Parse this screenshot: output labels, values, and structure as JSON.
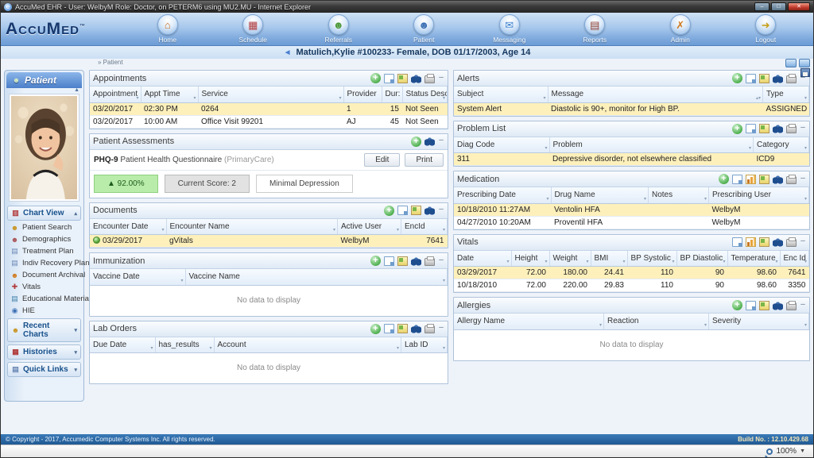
{
  "window": {
    "title": "AccuMed EHR - User: WelbyM Role: Doctor, on PETERM6 using MU2.MU - Internet Explorer",
    "favicon_glyph": "e",
    "min": "–",
    "max": "□",
    "close": "✕"
  },
  "nav": {
    "logo": "AccuMed",
    "logo_tm": "™",
    "items": [
      {
        "label": "Home",
        "glyph": "⌂",
        "color": "#c96a1a"
      },
      {
        "label": "Schedule",
        "glyph": "▦",
        "color": "#b03a3a"
      },
      {
        "label": "Referrals",
        "glyph": "☻",
        "color": "#4f9a3c"
      },
      {
        "label": "Patient",
        "glyph": "☻",
        "color": "#3b6fb4"
      },
      {
        "label": "Messaging",
        "glyph": "✉",
        "color": "#3b7fd0"
      },
      {
        "label": "Reports",
        "glyph": "▤",
        "color": "#8a3a2a"
      },
      {
        "label": "Admin",
        "glyph": "✗",
        "color": "#d07a20"
      },
      {
        "label": "Logout",
        "glyph": "➜",
        "color": "#c8a020"
      }
    ]
  },
  "banner": {
    "arrow": "◄",
    "text": "Matulich,Kylie #100233- Female, DOB 01/17/2003, Age 14"
  },
  "breadcrumb": {
    "text": "» Patient"
  },
  "sidebar": {
    "header": "Patient",
    "header_glyph": "☻",
    "chart_view": {
      "label": "Chart View",
      "chev": "▴"
    },
    "chart_items": [
      {
        "label": "Patient Search",
        "glyph": "☻",
        "color": "#c9931f"
      },
      {
        "label": "Demographics",
        "glyph": "☻",
        "color": "#a85050"
      },
      {
        "label": "Treatment Plan",
        "glyph": "▤",
        "color": "#6a87b5"
      },
      {
        "label": "Indiv Recovery Plan",
        "glyph": "▤",
        "color": "#6a87b5"
      },
      {
        "label": "Document Archival",
        "glyph": "☻",
        "color": "#d07a20"
      },
      {
        "label": "Vitals",
        "glyph": "✚",
        "color": "#b03a3a"
      },
      {
        "label": "Educational Materials",
        "glyph": "▤",
        "color": "#3f7fa8"
      },
      {
        "label": "HIE",
        "glyph": "◉",
        "color": "#3b6fb4"
      }
    ],
    "sections": [
      {
        "label": "Recent Charts",
        "glyph": "☻",
        "color": "#c9931f",
        "chev": "▾"
      },
      {
        "label": "Histories",
        "glyph": "▦",
        "color": "#b03a3a",
        "chev": "▾"
      },
      {
        "label": "Quick Links",
        "glyph": "▤",
        "color": "#6a87b5",
        "chev": "▾"
      }
    ]
  },
  "panels": {
    "appointments": {
      "title": "Appointments",
      "columns": [
        "Appointment",
        "Appt Time",
        "Service",
        "Provider",
        "Dur:",
        "Status Desc"
      ],
      "rows": [
        [
          "03/20/2017",
          "02:30 PM",
          "0264",
          "1",
          "15",
          "Not Seen"
        ],
        [
          "03/20/2017",
          "10:00 AM",
          "Office Visit 99201",
          "AJ",
          "45",
          "Not Seen"
        ]
      ]
    },
    "assessments": {
      "title": "Patient Assessments",
      "code": "PHQ-9",
      "name": "Patient Health Questionnaire",
      "scope": "(PrimaryCare)",
      "edit_label": "Edit",
      "print_label": "Print",
      "trend": "▲ 92.00%",
      "score": "Current Score: 2",
      "severity": "Minimal Depression"
    },
    "documents": {
      "title": "Documents",
      "columns": [
        "Encounter Date",
        "Encounter Name",
        "Active User",
        "EncId"
      ],
      "rows": [
        [
          "03/29/2017",
          "gVitals",
          "WelbyM",
          "7641"
        ]
      ]
    },
    "immunization": {
      "title": "Immunization",
      "columns": [
        "Vaccine Date",
        "Vaccine Name"
      ],
      "empty": "No data to display"
    },
    "lab_orders": {
      "title": "Lab Orders",
      "columns": [
        "Due Date",
        "has_results",
        "Account",
        "Lab ID"
      ],
      "empty": "No data to display"
    },
    "alerts": {
      "title": "Alerts",
      "columns": [
        "Subject",
        "Message",
        "Type"
      ],
      "rows": [
        [
          "System Alert",
          "Diastolic is 90+, monitor for High BP.",
          "ASSIGNED"
        ]
      ]
    },
    "problem_list": {
      "title": "Problem List",
      "columns": [
        "Diag Code",
        "Problem",
        "Category"
      ],
      "rows": [
        [
          "311",
          "Depressive disorder, not elsewhere classified",
          "ICD9"
        ]
      ]
    },
    "medication": {
      "title": "Medication",
      "columns": [
        "Prescribing Date",
        "Drug Name",
        "Notes",
        "Prescribing User"
      ],
      "rows": [
        [
          "10/18/2010 11:27AM",
          "Ventolin HFA",
          "",
          "WelbyM"
        ],
        [
          "04/27/2010 10:20AM",
          "Proventil HFA",
          "",
          "WelbyM"
        ]
      ]
    },
    "vitals": {
      "title": "Vitals",
      "columns": [
        "Date",
        "Height",
        "Weight",
        "BMI",
        "BP Systolic",
        "BP Diastolic",
        "Temperature",
        "Enc Id"
      ],
      "rows": [
        [
          "03/29/2017",
          "72.00",
          "180.00",
          "24.41",
          "110",
          "90",
          "98.60",
          "7641"
        ],
        [
          "10/18/2010",
          "72.00",
          "220.00",
          "29.83",
          "110",
          "90",
          "98.60",
          "3350"
        ]
      ]
    },
    "allergies": {
      "title": "Allergies",
      "columns": [
        "Allergy Name",
        "Reaction",
        "Severity"
      ],
      "empty": "No data to display"
    }
  },
  "footer": {
    "copyright": "© Copyright - 2017, Accumedic Computer Systems Inc. All rights reserved.",
    "build": "Build No. : 12.10.429.68",
    "zoom": "100%"
  }
}
